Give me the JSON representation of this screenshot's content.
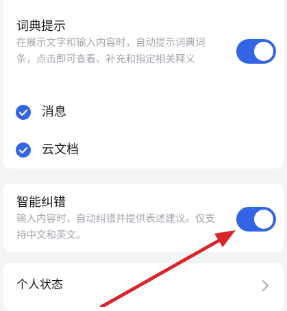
{
  "dictionary_hint": {
    "title": "词典提示",
    "description": "在展示文字和输入内容时，自动提示词典词条，点击即可查看、补充和指定相关释义",
    "enabled": true,
    "options": [
      {
        "label": "消息",
        "checked": true
      },
      {
        "label": "云文档",
        "checked": true
      }
    ]
  },
  "smart_correction": {
    "title": "智能纠错",
    "description": "输入内容时，自动纠错并提供表述建议。仅支持中文和英文。",
    "enabled": true
  },
  "personal_status": {
    "title": "个人状态"
  },
  "colors": {
    "accent": "#3264e6",
    "annotation_arrow": "#d9262b"
  }
}
